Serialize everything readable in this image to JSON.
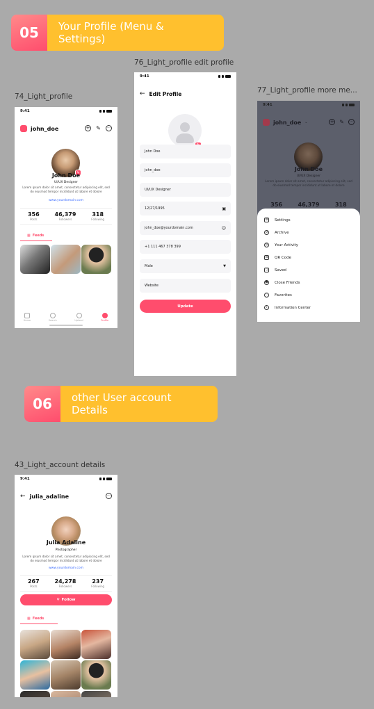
{
  "section5": {
    "num": "05",
    "label": "Your Profile (Menu & Settings)"
  },
  "section6": {
    "num": "06",
    "label": "other User account Details"
  },
  "captions": {
    "light_profile": "74_Light_profile",
    "edit_profile": "76_Light_profile edit profile",
    "more_menu": "77_Light_profile more me...",
    "account_details": "43_Light_account details"
  },
  "status_time": "9:41",
  "profile": {
    "username": "john_doe",
    "name": "John Doe",
    "role": "UI/UX Designer",
    "bio": "Lorem ipsum dolor sit amet, consectetur adipiscing elit, sed do eiusmod tempor incididunt ut labore et dolore",
    "link": "www.yourdomain.com",
    "stats": [
      {
        "value": "356",
        "label": "Posts"
      },
      {
        "value": "46,379",
        "label": "Followers"
      },
      {
        "value": "318",
        "label": "Following"
      }
    ],
    "feeds_label": "Feeds",
    "nav": [
      "Home",
      "Search",
      "Upload",
      "Profile"
    ]
  },
  "edit": {
    "title": "Edit Profile",
    "fields": [
      "John Doe",
      "john_doe",
      "UI/UX Designer",
      "12/27/1995",
      "john_doe@yourdomain.com",
      "+1 111 467 378 399",
      "Male",
      "Website"
    ],
    "update_label": "Update"
  },
  "menu": {
    "items": [
      "Settings",
      "Archive",
      "Your Activity",
      "QR Code",
      "Saved",
      "Close Friends",
      "Favorites",
      "Information Center"
    ]
  },
  "account": {
    "username": "julia_adaline",
    "name": "Julia Adaline",
    "role": "Photographer",
    "bio": "Lorem ipsum dolor sit amet, consectetur adipiscing elit, sed do eiusmod tempor incididunt ut labore et dolore",
    "link": "www.yourdomain.com",
    "stats": [
      {
        "value": "267",
        "label": "Posts"
      },
      {
        "value": "24,278",
        "label": "Followers"
      },
      {
        "value": "237",
        "label": "Following"
      }
    ],
    "follow_label": "Follow",
    "feeds_label": "Feeds"
  },
  "colors": {
    "accent": "#ff4d6d",
    "yellow": "#ffc02e",
    "background": "#aaaaaa"
  }
}
